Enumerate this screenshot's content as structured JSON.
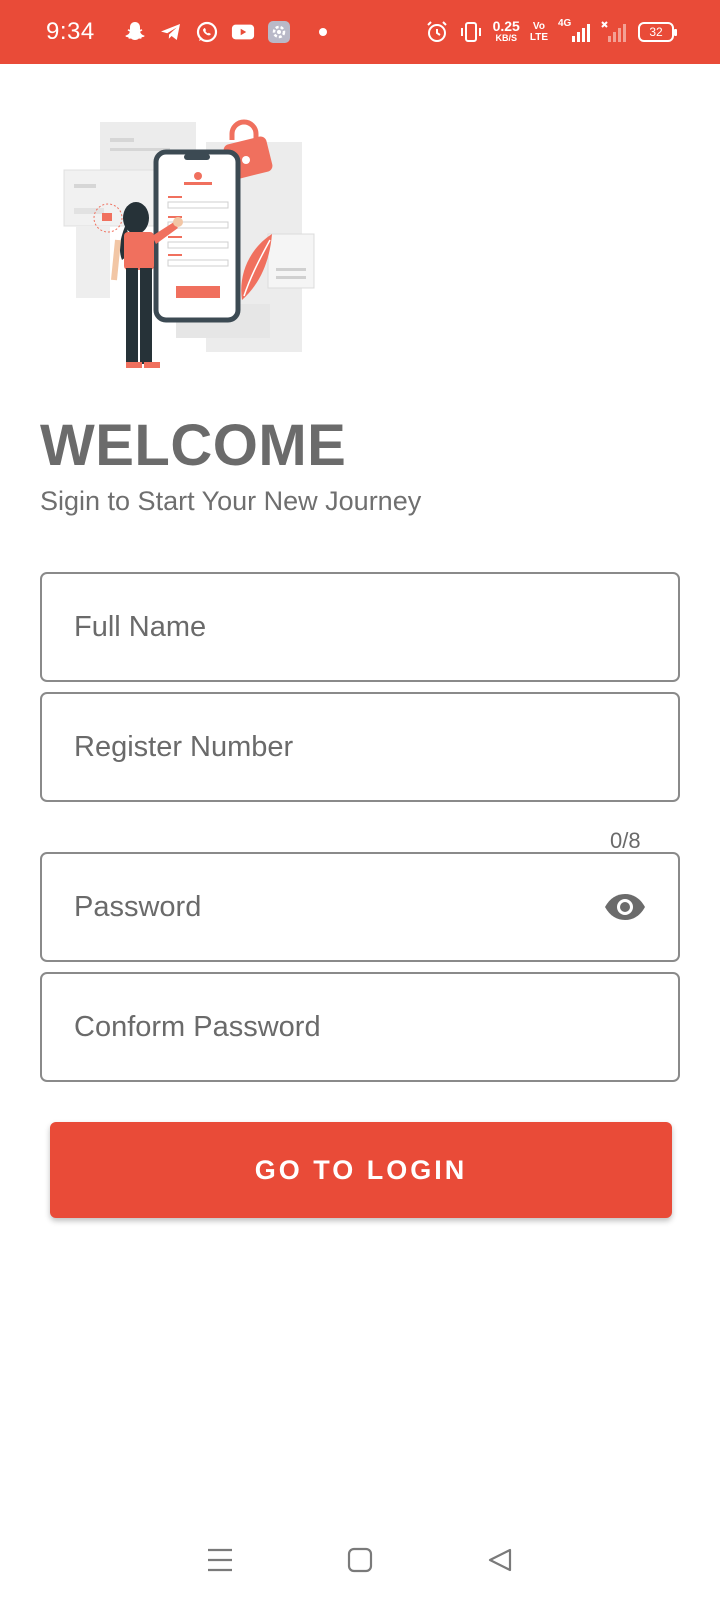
{
  "status_bar": {
    "time": "9:34",
    "net_speed_value": "0.25",
    "net_speed_unit": "KB/S",
    "volte_top": "Vo",
    "volte_bottom": "LTE",
    "network_type": "4G",
    "battery": "32",
    "colors": {
      "background": "#e94b38",
      "foreground": "#ffffff"
    }
  },
  "header": {
    "title": "WELCOME",
    "subtitle": "Sigin to Start Your New Journey"
  },
  "form": {
    "full_name": {
      "placeholder": "Full Name",
      "value": ""
    },
    "register_number": {
      "placeholder": "Register Number",
      "value": "",
      "counter": "0/8"
    },
    "password": {
      "placeholder": "Password",
      "value": ""
    },
    "confirm_password": {
      "placeholder": "Conform Password",
      "value": ""
    }
  },
  "actions": {
    "login_label": "GO TO LOGIN"
  },
  "nav": {
    "icons": [
      "menu-icon",
      "home-square-icon",
      "back-triangle-icon"
    ]
  },
  "theme": {
    "accent": "#e94b38",
    "text_gray": "#6b6b6b",
    "border_gray": "#8a8a8a"
  }
}
